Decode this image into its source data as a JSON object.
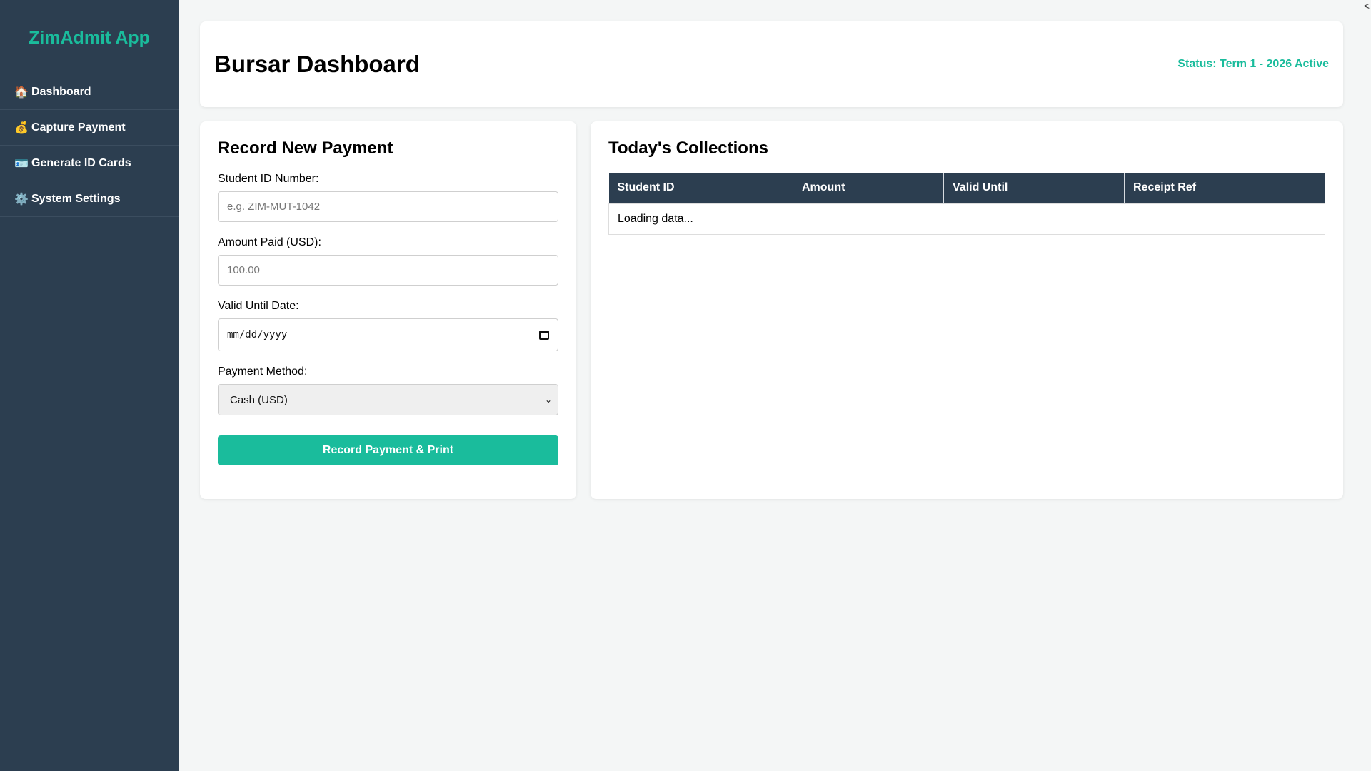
{
  "app": {
    "brand": "ZimAdmit App"
  },
  "sidebar": {
    "items": [
      {
        "icon": "🏠",
        "label": "Dashboard"
      },
      {
        "icon": "💰",
        "label": "Capture Payment"
      },
      {
        "icon": "🪪",
        "label": "Generate ID Cards"
      },
      {
        "icon": "⚙️",
        "label": "System Settings"
      }
    ]
  },
  "header": {
    "title": "Bursar Dashboard",
    "status": "Status: Term 1 - 2026 Active"
  },
  "form": {
    "title": "Record New Payment",
    "student_id": {
      "label": "Student ID Number:",
      "placeholder": "e.g. ZIM-MUT-1042",
      "value": ""
    },
    "amount": {
      "label": "Amount Paid (USD):",
      "placeholder": "100.00",
      "value": ""
    },
    "valid_until": {
      "label": "Valid Until Date:",
      "placeholder": "mm/dd/yyyy"
    },
    "method": {
      "label": "Payment Method:",
      "selected": "Cash (USD)"
    },
    "submit_label": "Record Payment & Print"
  },
  "collections": {
    "title": "Today's Collections",
    "columns": [
      "Student ID",
      "Amount",
      "Valid Until",
      "Receipt Ref"
    ],
    "loading_text": "Loading data..."
  },
  "corner": {
    "glyph": "<"
  },
  "colors": {
    "accent": "#1abc9c",
    "sidebar_bg": "#2c3e50",
    "page_bg": "#f4f6f6"
  }
}
